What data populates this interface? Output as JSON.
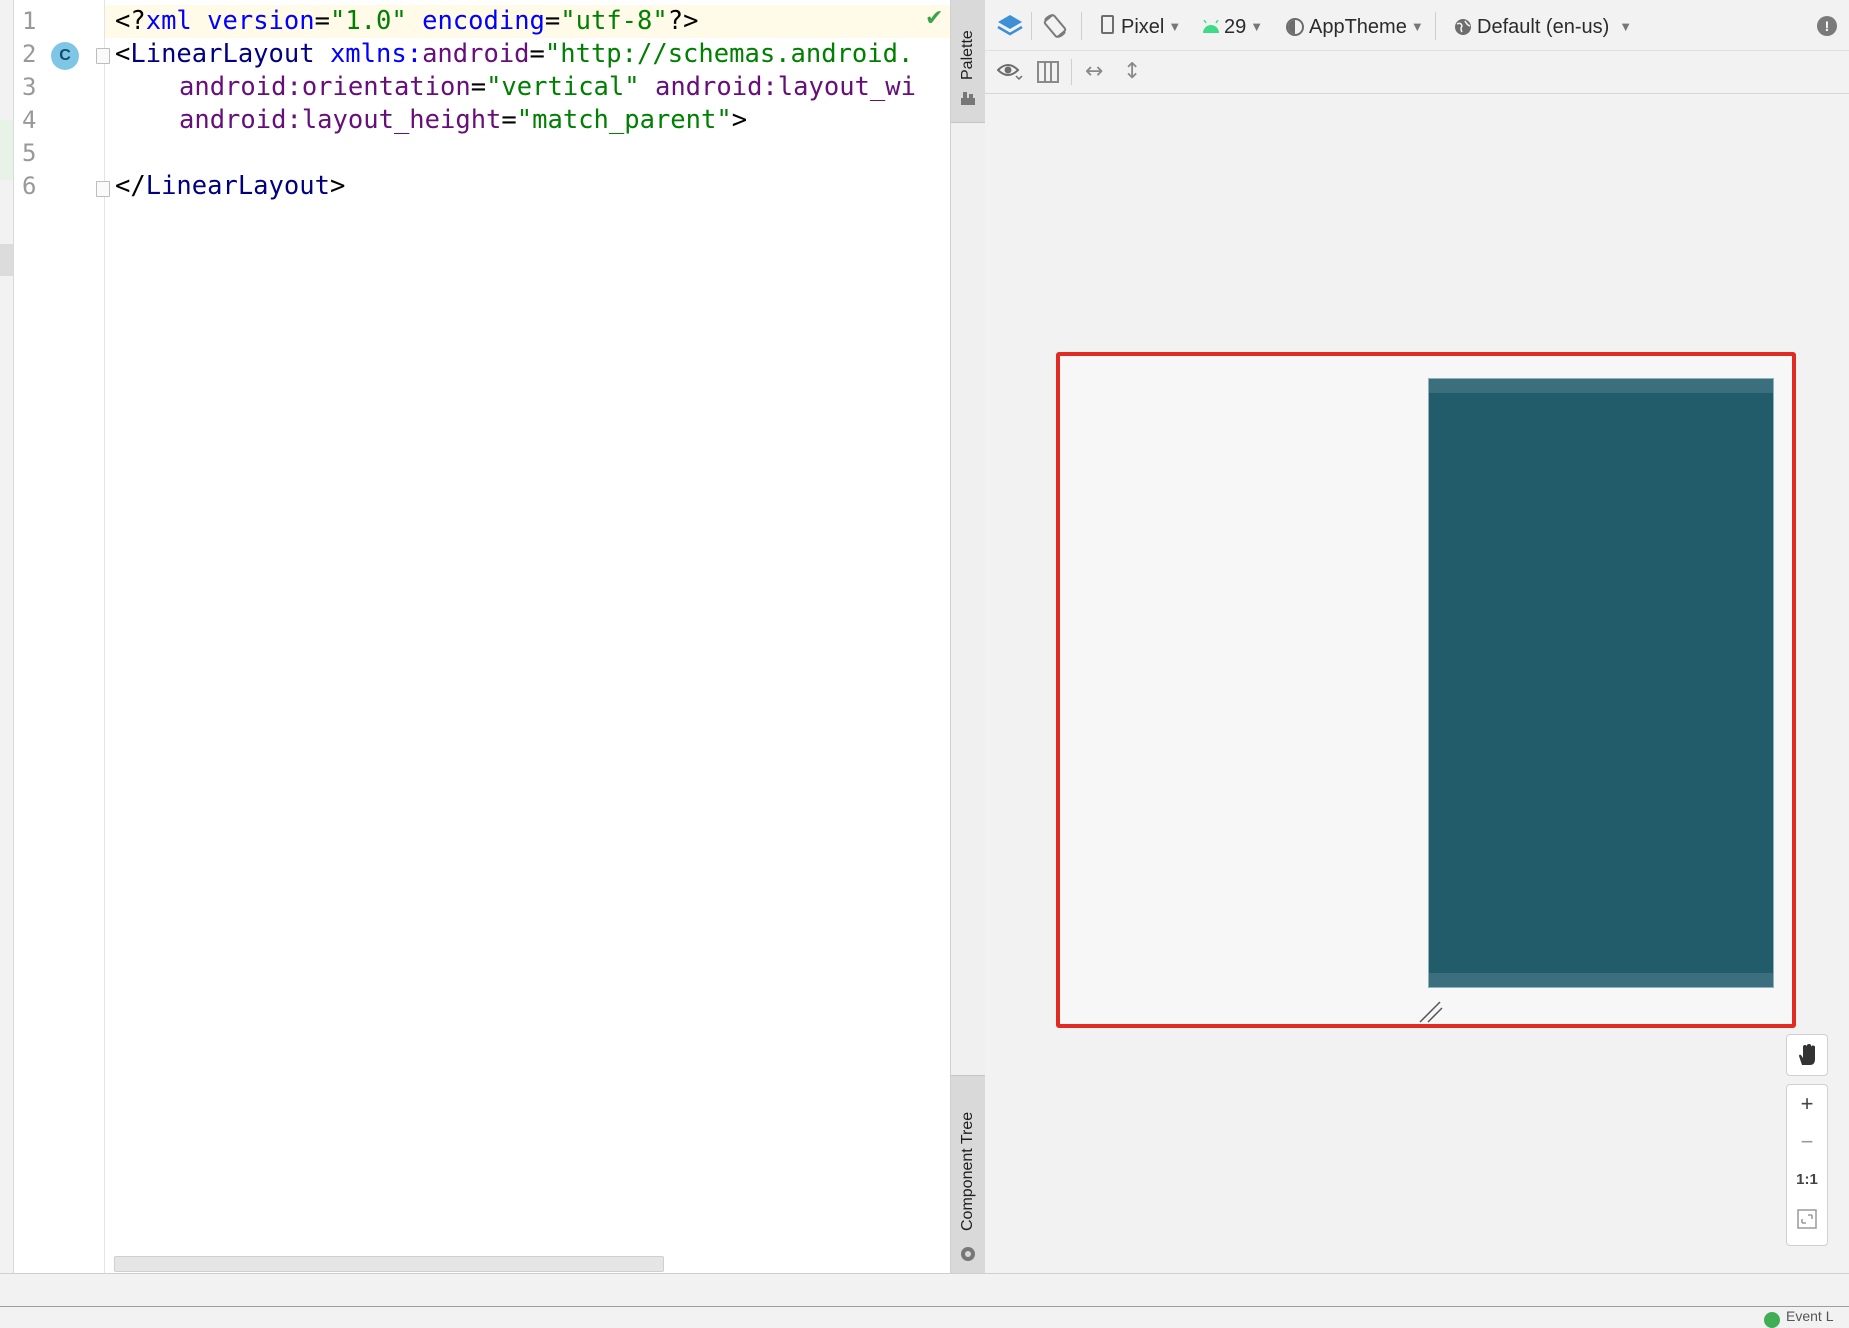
{
  "editor": {
    "line_numbers": [
      "1",
      "2",
      "3",
      "4",
      "5",
      "6"
    ],
    "code": {
      "line1": {
        "open": "<?",
        "tag": "xml",
        "a1": " version",
        "eq1": "=",
        "v1": "\"1.0\"",
        "a2": " encoding",
        "eq2": "=",
        "v2": "\"utf-8\"",
        "close": "?>"
      },
      "line2": {
        "open": "<",
        "tag": "LinearLayout",
        "ns_attr": " xmlns:",
        "ns_attr2": "android",
        "eq": "=",
        "val": "\"http://schemas.android."
      },
      "line3": {
        "ns": "android:",
        "attr": "orientation",
        "eq": "=",
        "val": "\"vertical\"",
        "ns2": " android:",
        "attr2": "layout_wi"
      },
      "line4": {
        "ns": "android:",
        "attr": "layout_height",
        "eq": "=",
        "val": "\"match_parent\"",
        "close": ">"
      },
      "line6": {
        "open": "</",
        "tag": "LinearLayout",
        "close": ">"
      }
    },
    "class_badge": "C"
  },
  "side_tabs": {
    "palette": "Palette",
    "component_tree": "Component Tree"
  },
  "toolbar": {
    "device": "Pixel",
    "api": "29",
    "theme": "AppTheme",
    "locale": "Default (en-us)"
  },
  "zoom": {
    "plus": "+",
    "minus": "−",
    "one_to_one": "1:1"
  },
  "status": {
    "text": "Event L"
  },
  "colors": {
    "accent_red": "#e12a22",
    "blueprint": "#225c6b"
  }
}
